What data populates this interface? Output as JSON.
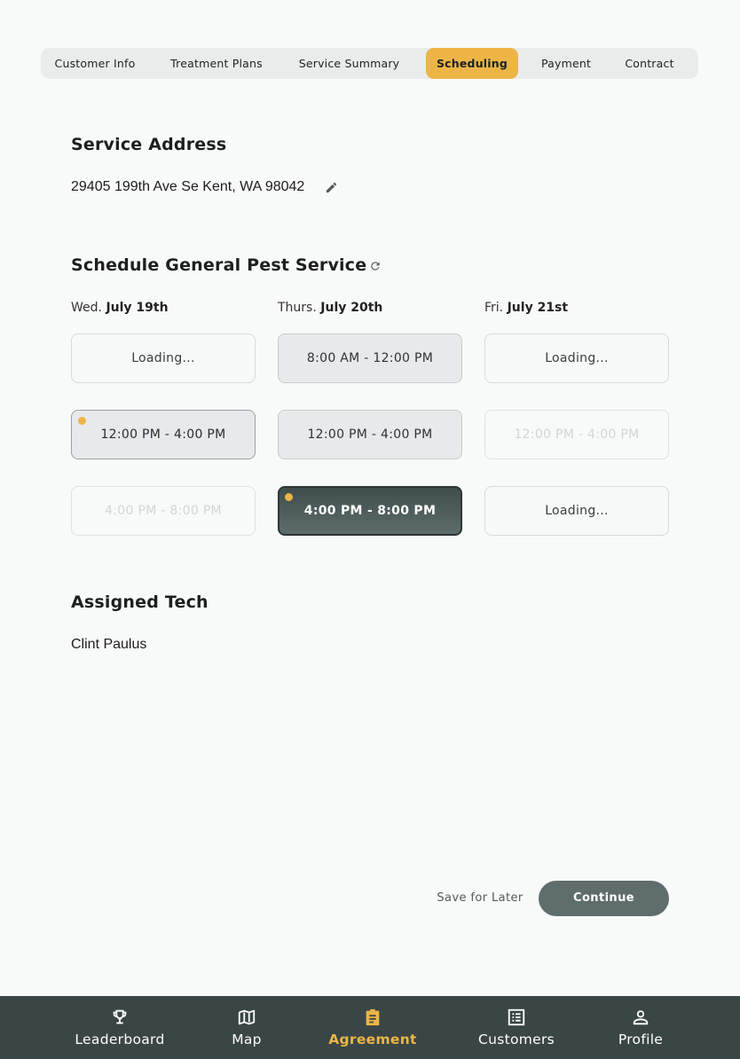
{
  "tabs": [
    {
      "label": "Customer Info",
      "active": false
    },
    {
      "label": "Treatment Plans",
      "active": false
    },
    {
      "label": "Service Summary",
      "active": false
    },
    {
      "label": "Scheduling",
      "active": true
    },
    {
      "label": "Payment",
      "active": false
    },
    {
      "label": "Contract",
      "active": false
    }
  ],
  "service_address": {
    "heading": "Service Address",
    "address": "29405 199th Ave Se Kent, WA 98042",
    "edit_icon": "pencil-icon"
  },
  "schedule": {
    "heading": "Schedule General Pest Service",
    "refresh_icon": "refresh-icon",
    "days": [
      {
        "weekday": "Wed.",
        "date": "July 19th",
        "slots": [
          {
            "label": "Loading...",
            "state": "loading",
            "dot": false
          },
          {
            "label": "12:00 PM - 4:00 PM",
            "state": "available-marked",
            "dot": true
          },
          {
            "label": "4:00 PM - 8:00 PM",
            "state": "disabled",
            "dot": false
          }
        ]
      },
      {
        "weekday": "Thurs.",
        "date": "July 20th",
        "slots": [
          {
            "label": "8:00 AM - 12:00 PM",
            "state": "available",
            "dot": false
          },
          {
            "label": "12:00 PM - 4:00 PM",
            "state": "available",
            "dot": false
          },
          {
            "label": "4:00 PM - 8:00 PM",
            "state": "selected",
            "dot": true
          }
        ]
      },
      {
        "weekday": "Fri.",
        "date": "July 21st",
        "slots": [
          {
            "label": "Loading...",
            "state": "loading",
            "dot": false
          },
          {
            "label": "12:00 PM - 4:00 PM",
            "state": "disabled",
            "dot": false
          },
          {
            "label": "Loading...",
            "state": "loading",
            "dot": false
          }
        ]
      }
    ]
  },
  "assigned_tech": {
    "heading": "Assigned Tech",
    "name": "Clint Paulus"
  },
  "actions": {
    "save_later": "Save for Later",
    "continue": "Continue"
  },
  "nav": [
    {
      "label": "Leaderboard",
      "icon": "trophy-icon",
      "active": false
    },
    {
      "label": "Map",
      "icon": "map-icon",
      "active": false
    },
    {
      "label": "Agreement",
      "icon": "clipboard-icon",
      "active": true
    },
    {
      "label": "Customers",
      "icon": "list-icon",
      "active": false
    },
    {
      "label": "Profile",
      "icon": "person-icon",
      "active": false
    }
  ],
  "colors": {
    "accent": "#ecb546",
    "nav_background": "#3a4645",
    "selected_slot": "#4a5856",
    "continue_button": "#5f6e6c",
    "page_background": "#f8faf9"
  }
}
